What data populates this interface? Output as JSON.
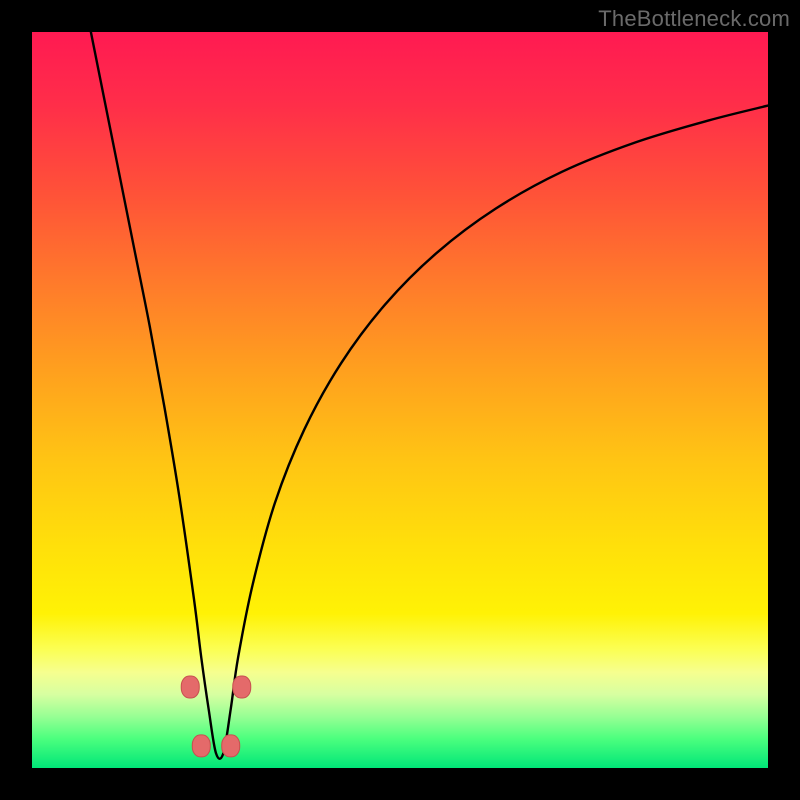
{
  "watermark": "TheBottleneck.com",
  "colors": {
    "page_bg": "#000000",
    "watermark": "#6a6a6a",
    "curve_stroke": "#000000",
    "marker_fill": "#e46a6a",
    "marker_stroke": "#c74f4f"
  },
  "chart_data": {
    "type": "line",
    "title": "",
    "xlabel": "",
    "ylabel": "",
    "xlim": [
      0,
      100
    ],
    "ylim": [
      0,
      100
    ],
    "grid": false,
    "note": "Decorative bottleneck curve over a red→green vertical heat gradient. Values are approximate pixel-percent positions (0–100) read off the image; the curve forms a deep V near x≈25 with four rounded markers near the trough.",
    "series": [
      {
        "name": "bottleneck-curve",
        "x": [
          8,
          10,
          12,
          14,
          16,
          18,
          20,
          22,
          23,
          24,
          25,
          26,
          27,
          28,
          30,
          33,
          37,
          42,
          48,
          55,
          63,
          72,
          82,
          92,
          100
        ],
        "y": [
          100,
          90,
          80,
          70,
          60,
          49,
          37,
          23,
          15,
          8,
          2,
          2,
          8,
          15,
          25,
          36,
          46,
          55,
          63,
          70,
          76,
          81,
          85,
          88,
          90
        ]
      }
    ],
    "markers": [
      {
        "x": 21.5,
        "y": 11
      },
      {
        "x": 28.5,
        "y": 11
      },
      {
        "x": 23.0,
        "y": 3
      },
      {
        "x": 27.0,
        "y": 3
      }
    ]
  }
}
